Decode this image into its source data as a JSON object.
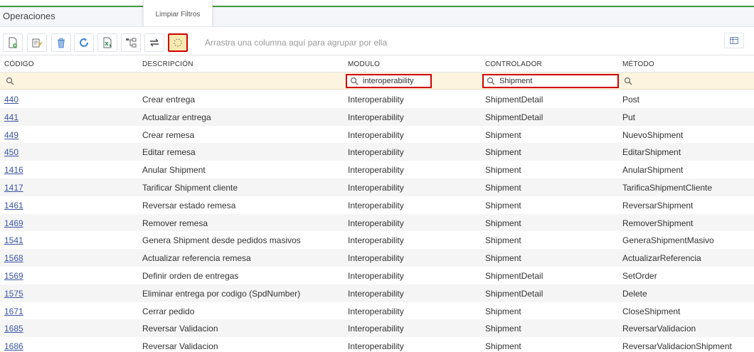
{
  "panel": {
    "title": "Operaciones"
  },
  "tooltip": {
    "text": "Limpiar Filtros"
  },
  "toolbar": {
    "buttons": [
      {
        "name": "new-record-icon"
      },
      {
        "name": "edit-record-icon"
      },
      {
        "name": "delete-icon"
      },
      {
        "name": "refresh-icon"
      },
      {
        "name": "export-excel-icon"
      },
      {
        "name": "hierarchy-icon"
      },
      {
        "name": "swap-icon"
      },
      {
        "name": "clear-filters-icon"
      }
    ],
    "group_hint": "Arrastra una columna aquí para agrupar por ella",
    "columns_button": "column-chooser-icon"
  },
  "columns": [
    "CÓDIGO",
    "DESCRIPCIÓN",
    "MODULO",
    "CONTROLADOR",
    "MÉTODO"
  ],
  "filters": {
    "codigo": "",
    "modulo": "interoperability",
    "controlador": "Shipment",
    "metodo": ""
  },
  "rows": [
    {
      "codigo": "440",
      "descripcion": "Crear entrega",
      "modulo": "Interoperability",
      "controlador": "ShipmentDetail",
      "metodo": "Post"
    },
    {
      "codigo": "441",
      "descripcion": "Actualizar entrega",
      "modulo": "Interoperability",
      "controlador": "ShipmentDetail",
      "metodo": "Put"
    },
    {
      "codigo": "449",
      "descripcion": "Crear remesa",
      "modulo": "Interoperability",
      "controlador": "Shipment",
      "metodo": "NuevoShipment"
    },
    {
      "codigo": "450",
      "descripcion": "Editar remesa",
      "modulo": "Interoperability",
      "controlador": "Shipment",
      "metodo": "EditarShipment"
    },
    {
      "codigo": "1416",
      "descripcion": "Anular Shipment",
      "modulo": "Interoperability",
      "controlador": "Shipment",
      "metodo": "AnularShipment"
    },
    {
      "codigo": "1417",
      "descripcion": "Tarificar Shipment cliente",
      "modulo": "Interoperability",
      "controlador": "Shipment",
      "metodo": "TarificaShipmentCliente"
    },
    {
      "codigo": "1461",
      "descripcion": "Reversar estado remesa",
      "modulo": "Interoperability",
      "controlador": "Shipment",
      "metodo": "ReversarShipment"
    },
    {
      "codigo": "1469",
      "descripcion": "Remover remesa",
      "modulo": "Interoperability",
      "controlador": "Shipment",
      "metodo": "RemoverShipment"
    },
    {
      "codigo": "1541",
      "descripcion": "Genera Shipment desde pedidos masivos",
      "modulo": "Interoperability",
      "controlador": "Shipment",
      "metodo": "GeneraShipmentMasivo"
    },
    {
      "codigo": "1568",
      "descripcion": "Actualizar referencia remesa",
      "modulo": "Interoperability",
      "controlador": "Shipment",
      "metodo": "ActualizarReferencia"
    },
    {
      "codigo": "1569",
      "descripcion": "Definir orden de entregas",
      "modulo": "Interoperability",
      "controlador": "ShipmentDetail",
      "metodo": "SetOrder"
    },
    {
      "codigo": "1575",
      "descripcion": "Eliminar entrega por codigo (SpdNumber)",
      "modulo": "Interoperability",
      "controlador": "ShipmentDetail",
      "metodo": "Delete"
    },
    {
      "codigo": "1671",
      "descripcion": "Cerrar pedido",
      "modulo": "Interoperability",
      "controlador": "Shipment",
      "metodo": "CloseShipment"
    },
    {
      "codigo": "1685",
      "descripcion": "Reversar Validacion",
      "modulo": "Interoperability",
      "controlador": "Shipment",
      "metodo": "ReversarValidacion"
    },
    {
      "codigo": "1686",
      "descripcion": "Reversar Validacion",
      "modulo": "Interoperability",
      "controlador": "Shipment",
      "metodo": "ReversarValidacionShipment"
    }
  ],
  "colors": {
    "accent_green": "#3c9a3c",
    "link": "#3b55a5",
    "highlight": "#d00000",
    "filter_bg": "#fcf4de"
  }
}
